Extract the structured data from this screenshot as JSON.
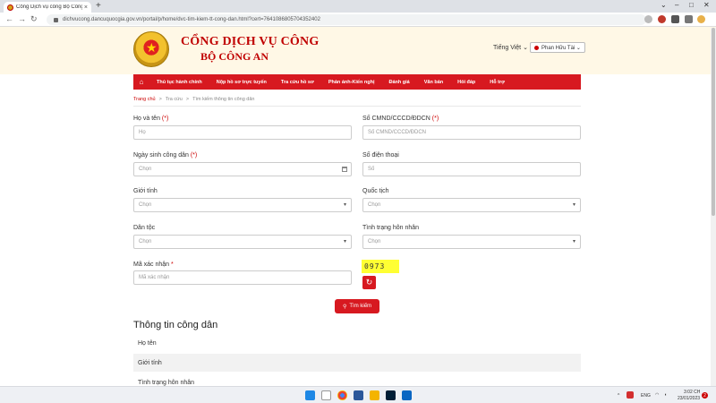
{
  "browser": {
    "tab_title": "Cổng Dịch vụ công Bộ Công An",
    "tab_close": "×",
    "new_tab": "+",
    "url": "dichvucong.dancuquocgia.gov.vn/portal/p/home/dvc-tim-kiem-tt-cong-dan.html?cert=764108680570435240​2"
  },
  "header": {
    "title_line1": "CỔNG DỊCH VỤ CÔNG",
    "title_line2": "BỘ CÔNG AN",
    "language": "Tiếng Việt ⌄",
    "user_name": "Phan Hữu Tài ⌄"
  },
  "nav": {
    "home_icon": "⌂",
    "items": [
      "Thủ tục hành chính",
      "Nộp hồ sơ trực tuyến",
      "Tra cứu hồ sơ",
      "Phản ánh-Kiến nghị",
      "Đánh giá",
      "Văn bản",
      "Hỏi đáp",
      "Hỗ trợ"
    ]
  },
  "breadcrumb": {
    "items": [
      "Trang chủ",
      "Tra cứu",
      "Tìm kiếm thông tin công dân"
    ],
    "sep": ">"
  },
  "form": {
    "required_mark": "(*)",
    "required_star": "*",
    "full_name_label": "Họ và tên",
    "full_name_placeholder": "Họ",
    "id_label": "Số CMND/CCCD/ĐDCN",
    "id_placeholder": "Số CMND/CCCD/ĐDCN",
    "dob_label": "Ngày sinh công dân",
    "dob_placeholder": "Chọn",
    "phone_label": "Số điện thoại",
    "phone_placeholder": "Số",
    "gender_label": "Giới tính",
    "gender_value": "Chọn",
    "nationality_label": "Quốc tịch",
    "nationality_value": "Chọn",
    "ethnicity_label": "Dân tộc",
    "ethnicity_value": "Chọn",
    "marital_label": "Tình trạng hôn nhân",
    "marital_value": "Chọn",
    "captcha_label": "Mã xác nhận",
    "captcha_placeholder": "Mã xác nhận",
    "captcha_code": "0973",
    "search_button": "Tìm kiếm"
  },
  "results": {
    "title": "Thông tin công dân",
    "rows": [
      "Họ tên",
      "Giới tính",
      "Tình trạng hôn nhân"
    ]
  },
  "taskbar": {
    "lang": "ENG",
    "time": "3:02 CH",
    "date": "23/01/2023",
    "notifications": "2"
  },
  "colors": {
    "brand_red": "#d71920",
    "header_bg": "#fff8e6",
    "captcha_bg": "#ffff33"
  }
}
